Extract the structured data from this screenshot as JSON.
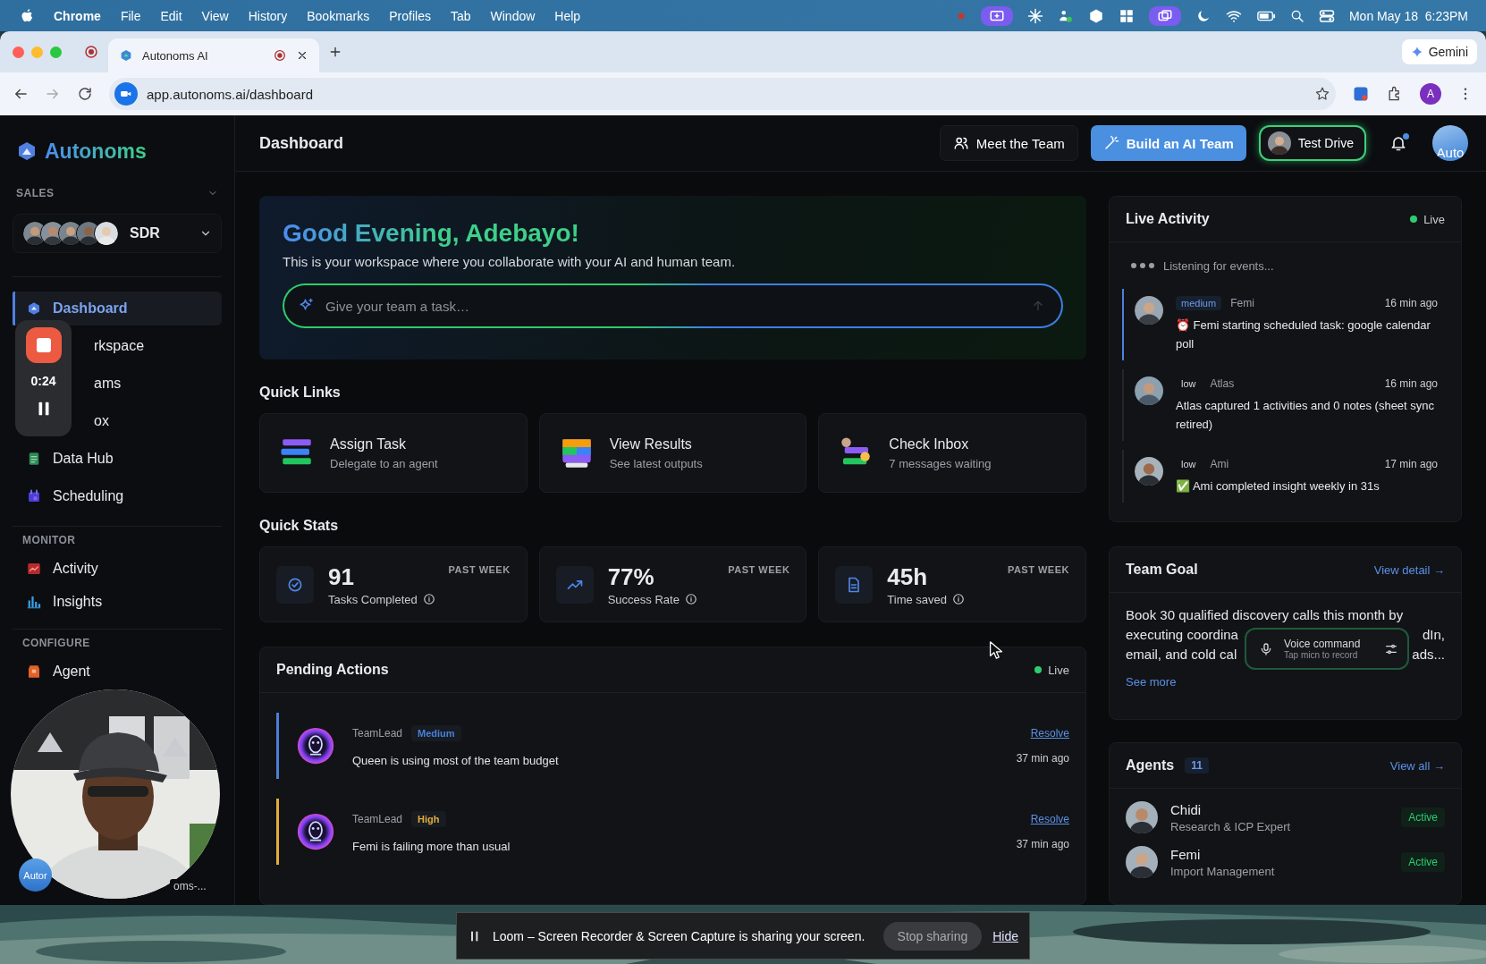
{
  "menubar": {
    "app": "Chrome",
    "menus": [
      "File",
      "Edit",
      "View",
      "History",
      "Bookmarks",
      "Profiles",
      "Tab",
      "Window",
      "Help"
    ],
    "clock": "Mon May 18  6:23PM"
  },
  "browser": {
    "tabs": [
      {
        "title": "Autonoms AI",
        "selected": true
      }
    ],
    "gemini": "Gemini",
    "url": "app.autonoms.ai/dashboard",
    "profile_initial": "A"
  },
  "sidebar": {
    "logo": "Autonoms",
    "section": "SALES",
    "team": "SDR",
    "groups": [
      {
        "items": [
          {
            "label": "Dashboard",
            "kind": "full",
            "selected": true
          },
          {
            "label": "rkspace",
            "kind": "covered",
            "selected": false
          },
          {
            "label": "ams",
            "kind": "covered",
            "selected": false
          },
          {
            "label": "ox",
            "kind": "covered",
            "selected": false
          },
          {
            "label": "Data Hub",
            "kind": "full",
            "selected": false
          },
          {
            "label": "Scheduling",
            "kind": "full",
            "selected": false
          }
        ]
      },
      {
        "title": "MONITOR",
        "items": [
          {
            "label": "Activity",
            "kind": "full",
            "selected": false
          },
          {
            "label": "Insights",
            "kind": "full",
            "selected": false
          }
        ]
      },
      {
        "title": "CONFIGURE",
        "items": [
          {
            "label": "Agent",
            "kind": "full",
            "selected": false
          }
        ]
      }
    ]
  },
  "header": {
    "title": "Dashboard",
    "meet": "Meet the Team",
    "build": "Build an AI Team",
    "test_drive": "Test Drive",
    "avatar_text": "Auto"
  },
  "hero": {
    "greeting": "Good Evening, Adebayo!",
    "subtitle": "This is your workspace where you collaborate with your AI and human team.",
    "placeholder": "Give your team a task…"
  },
  "quick_links": {
    "title": "Quick Links",
    "items": [
      {
        "title": "Assign Task",
        "subtitle": "Delegate to an agent"
      },
      {
        "title": "View Results",
        "subtitle": "See latest outputs"
      },
      {
        "title": "Check Inbox",
        "subtitle": "7 messages waiting"
      }
    ]
  },
  "quick_stats": {
    "title": "Quick Stats",
    "items": [
      {
        "value": "91",
        "label": "Tasks Completed",
        "period": "PAST WEEK"
      },
      {
        "value": "77%",
        "label": "Success Rate",
        "period": "PAST WEEK"
      },
      {
        "value": "45h",
        "label": "Time saved",
        "period": "PAST WEEK"
      }
    ]
  },
  "pending_actions": {
    "title": "Pending Actions",
    "live": "Live",
    "items": [
      {
        "source": "TeamLead",
        "priority": "Medium",
        "color": "#4a7fd8",
        "text": "Queen is using most of the team budget",
        "action": "Resolve",
        "time": "37 min ago"
      },
      {
        "source": "TeamLead",
        "priority": "High",
        "color": "#e3ac3c",
        "text": "Femi is failing more than usual",
        "action": "Resolve",
        "time": "37 min ago"
      }
    ]
  },
  "live_activity": {
    "title": "Live Activity",
    "live": "Live",
    "listening": "Listening for events...",
    "events": [
      {
        "level": "medium",
        "agent": "Femi",
        "time": "16 min ago",
        "text": "⏰ Femi starting scheduled task: google calendar poll",
        "selected": true
      },
      {
        "level": "low",
        "agent": "Atlas",
        "time": "16 min ago",
        "text": "Atlas captured 1 activities and 0 notes (sheet sync retired)",
        "selected": false
      },
      {
        "level": "low",
        "agent": "Ami",
        "time": "17 min ago",
        "text": "✅ Ami completed insight weekly in 31s",
        "selected": false
      }
    ]
  },
  "team_goal": {
    "title": "Team Goal",
    "link": "View detail →",
    "lines": [
      {
        "left": "Book 30 qualified discovery calls this month by"
      },
      {
        "left": "executing coordina",
        "right": "dIn,"
      },
      {
        "left": "email, and cold cal",
        "right": "ads..."
      }
    ],
    "more": "See more"
  },
  "agents": {
    "title": "Agents",
    "count": "11",
    "link": "View all →",
    "items": [
      {
        "name": "Chidi",
        "role": "Research & ICP Expert",
        "status": "Active"
      },
      {
        "name": "Femi",
        "role": "Import Management",
        "status": "Active"
      }
    ]
  },
  "recorder": {
    "time": "0:24"
  },
  "camera": {
    "avatar_text": "Autor",
    "name": "oms-..."
  },
  "voice_command": {
    "title": "Voice command",
    "hint": "Tap micn to record"
  },
  "share_bar": {
    "text": "Loom – Screen Recorder & Screen Capture is sharing your screen.",
    "stop": "Stop sharing",
    "hide": "Hide"
  }
}
